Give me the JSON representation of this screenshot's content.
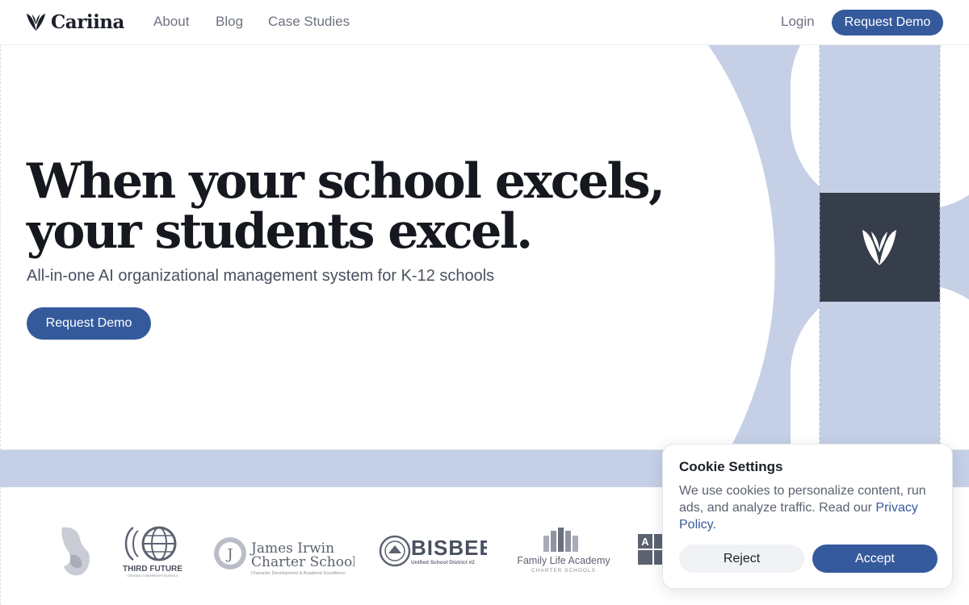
{
  "brand": {
    "name": "Cariina",
    "accent": "#355a9c",
    "art_light": "#c5d0e6",
    "art_dark": "#363d4b"
  },
  "nav": {
    "links": [
      "About",
      "Blog",
      "Case Studies"
    ],
    "login": "Login",
    "cta": "Request Demo"
  },
  "hero": {
    "headline_line1": "When your school excels,",
    "headline_line2": "your students excel.",
    "subhead": "All-in-one AI organizational management system for K-12 schools",
    "cta": "Request Demo"
  },
  "partners": {
    "third_future": {
      "name": "THIRD FUTURE",
      "tagline": "CREATING TOMORROW'S SCHOOLS"
    },
    "james_irwin": {
      "line1": "James Irwin",
      "line2": "Charter Schools",
      "tagline": "Character Development & Academic Excellence"
    },
    "bisbee": {
      "name": "BISBEE",
      "tagline": "Unified School District #2"
    },
    "family_life": {
      "name": "Family Life Academy",
      "tagline": "CHARTER SCHOOLS"
    }
  },
  "cookie": {
    "title": "Cookie Settings",
    "body": "We use cookies to personalize content, run ads, and analyze traffic. Read our ",
    "link": "Privacy Policy",
    "period": ".",
    "reject": "Reject",
    "accept": "Accept"
  }
}
